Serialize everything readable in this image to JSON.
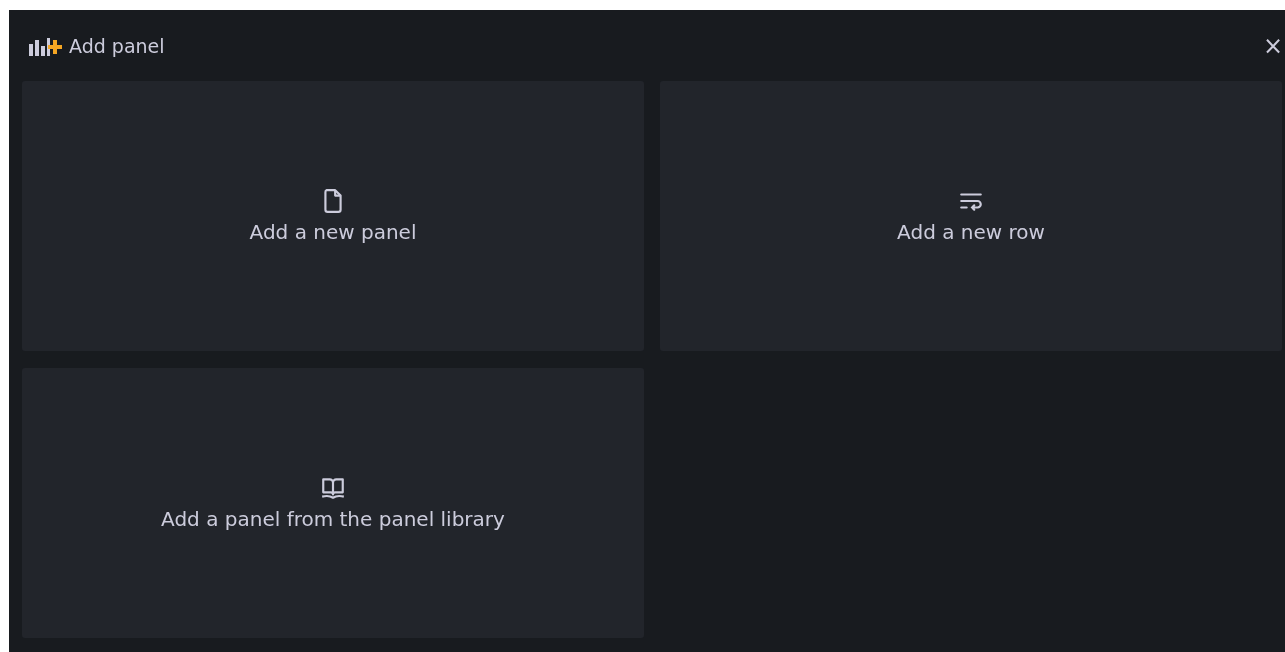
{
  "header": {
    "title": "Add panel",
    "close": "×"
  },
  "options": [
    {
      "kind": "panel",
      "label": "Add a new panel"
    },
    {
      "kind": "row",
      "label": "Add a new row"
    },
    {
      "kind": "library",
      "label": "Add a panel from the panel library"
    }
  ]
}
